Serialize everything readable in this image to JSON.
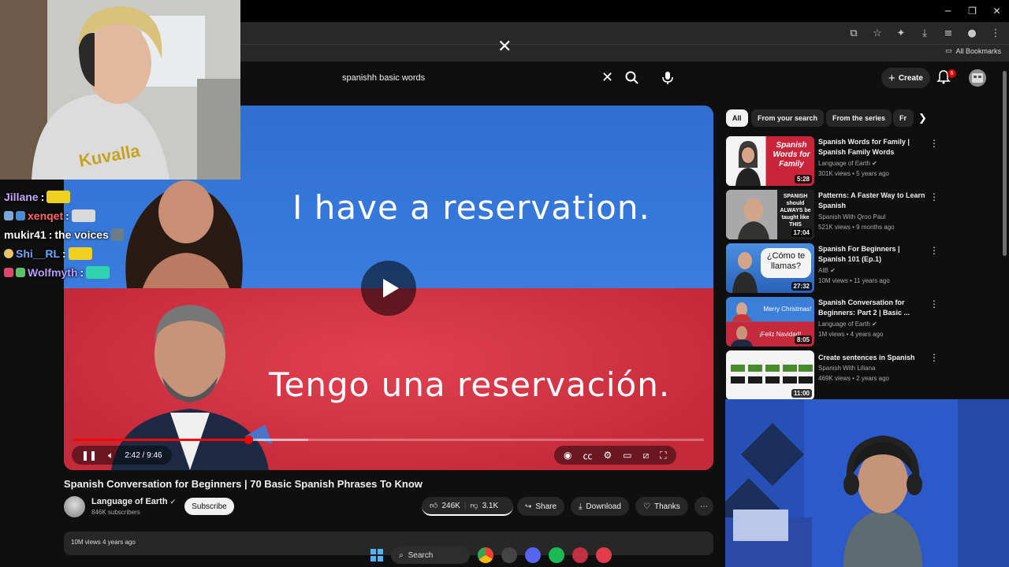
{
  "browser": {
    "bookmarks_label": "All Bookmarks",
    "overlay_close": "✕"
  },
  "header": {
    "search_value": "spanishh basic words",
    "create_label": "Create",
    "notification_count": "6"
  },
  "video": {
    "caption_en": "I have a reservation.",
    "caption_es": "Tengo una reservación.",
    "time": "2:42 / 9:46",
    "progress_fraction": 0.277,
    "buffered_fraction": 0.372,
    "title": "Spanish Conversation for Beginners | 70 Basic Spanish Phrases To Know",
    "channel_name": "Language of Earth",
    "channel_subs": "846K subscribers",
    "subscribe_label": "Subscribe",
    "likes": "246K",
    "dislikes": "3.1K",
    "share_label": "Share",
    "download_label": "Download",
    "thanks_label": "Thanks",
    "description_preview": "10M views  4 years ago"
  },
  "chips": {
    "all": "All",
    "from_search": "From your search",
    "from_series": "From the series",
    "more": "Fr"
  },
  "recommendations": [
    {
      "title": "Spanish Words for Family | Spanish Family Words",
      "channel": "Language of Earth",
      "meta": "301K views • 5 years ago",
      "duration": "5:28",
      "thumb_text": "Spanish Words for Family"
    },
    {
      "title": "Patterns: A Faster Way to Learn Spanish",
      "channel": "Spanish With Qroo Paul",
      "meta": "521K views • 9 months ago",
      "duration": "17:04",
      "thumb_text": "SPANISH should ALWAYS be taught like THIS"
    },
    {
      "title": "Spanish For Beginners | Spanish 101 (Ep.1)",
      "channel": "AIB",
      "meta": "10M views • 11 years ago",
      "duration": "27:32",
      "thumb_text": "¿Cómo te llamas?"
    },
    {
      "title": "Spanish Conversation for Beginners: Part 2 | Basic ...",
      "channel": "Language of Earth",
      "meta": "1M views • 4 years ago",
      "duration": "8:05",
      "thumb_text": "Merry Christmas!"
    },
    {
      "title": "Create sentences in Spanish",
      "channel": "Spanish With Liliana",
      "meta": "469K views • 2 years ago",
      "duration": "11:00",
      "thumb_text": ""
    }
  ],
  "chat": [
    {
      "user": "Jillane",
      "color": "#c8a8ff",
      "text": ""
    },
    {
      "user": "xenqet",
      "color": "#ff6b6b",
      "text": ""
    },
    {
      "user": "mukir41",
      "color": "#ffffff",
      "text": "the voices"
    },
    {
      "user": "Shi__RL",
      "color": "#6fa8ff",
      "text": ""
    },
    {
      "user": "Wolfmyth",
      "color": "#b89cff",
      "text": ""
    }
  ],
  "taskbar": {
    "search_label": "Search"
  },
  "colors": {
    "accent_red": "#ff0000",
    "bg": "#0f0f0f"
  }
}
